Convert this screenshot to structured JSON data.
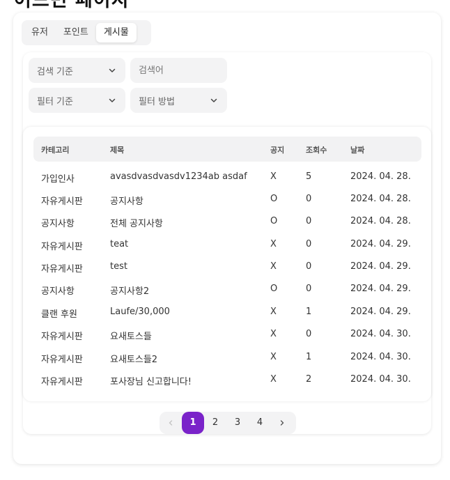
{
  "page": {
    "title": "어드민 페이지"
  },
  "tabs": [
    {
      "label": "유저"
    },
    {
      "label": "포인트"
    },
    {
      "label": "게시물",
      "active": true
    }
  ],
  "filters": {
    "search_by": {
      "label": "검색 기준"
    },
    "keyword": {
      "placeholder": "검색어",
      "value": ""
    },
    "filter_by": {
      "label": "필터 기준"
    },
    "filter_method": {
      "label": "필터 방법"
    }
  },
  "table": {
    "headers": [
      "카테고리",
      "제목",
      "공지",
      "조회수",
      "날짜"
    ],
    "rows": [
      [
        "가입인사",
        "avasdvasdvasdv1234ab asdaf",
        "X",
        "5",
        "2024. 04. 28."
      ],
      [
        "자유게시판",
        "공지사항",
        "O",
        "0",
        "2024. 04. 28."
      ],
      [
        "공지사항",
        "전체 공지사항",
        "O",
        "0",
        "2024. 04. 28."
      ],
      [
        "자유게시판",
        "teat",
        "X",
        "0",
        "2024. 04. 29."
      ],
      [
        "자유게시판",
        "test",
        "X",
        "0",
        "2024. 04. 29."
      ],
      [
        "공지사항",
        "공지사항2",
        "O",
        "0",
        "2024. 04. 29."
      ],
      [
        "클랜 후원",
        "Laufe/30,000",
        "X",
        "1",
        "2024. 04. 29."
      ],
      [
        "자유게시판",
        "요새토스들",
        "X",
        "0",
        "2024. 04. 30."
      ],
      [
        "자유게시판",
        "요새토스들2",
        "X",
        "1",
        "2024. 04. 30."
      ],
      [
        "자유게시판",
        "포사장님 신고합니다!",
        "X",
        "2",
        "2024. 04. 30."
      ]
    ]
  },
  "pagination": {
    "pages": [
      "1",
      "2",
      "3",
      "4"
    ],
    "current": "1",
    "prev_icon": "chevron-left-icon",
    "next_icon": "chevron-right-icon"
  },
  "colors": {
    "accent": "#7a23c9",
    "field_bg": "#f3f3f4"
  }
}
